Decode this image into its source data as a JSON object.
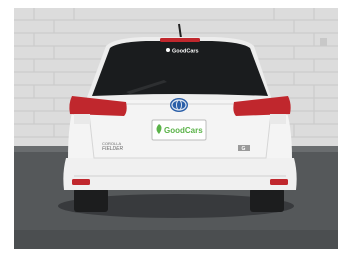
{
  "photo": {
    "subject": "rear view of white station wagon parked in front of brick wall",
    "window_sticker": "GoodCars",
    "plate_brand": "GoodCars",
    "model_badge_line1": "FIELDER",
    "model_badge_line2": "COROLLA",
    "trim_badge": "G",
    "emblem": "toyota-hybrid-emblem",
    "colors": {
      "wall": "#dcdcdc",
      "ground": "#55585a",
      "car_body": "#f4f4f4",
      "window": "#1a1c1e",
      "tail_light": "#c0272d",
      "logo_green": "#5bb349"
    }
  }
}
